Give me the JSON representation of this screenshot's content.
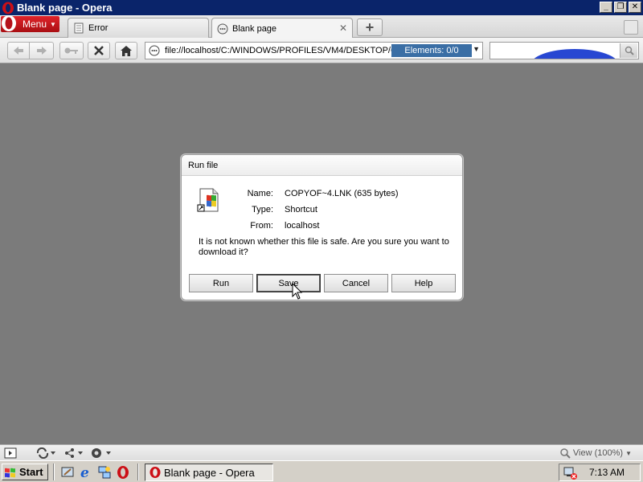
{
  "window": {
    "title": "Blank page - Opera"
  },
  "menu": {
    "label": "Menu"
  },
  "tabs": [
    {
      "label": "Error"
    },
    {
      "label": "Blank page"
    }
  ],
  "address": {
    "url": "file://localhost/C:/WINDOWS/PROFILES/VM4/DESKTOP/CC",
    "elements": "Elements:  0/0"
  },
  "dialog": {
    "title": "Run file",
    "name_label": "Name:",
    "name_value": "COPYOF~4.LNK (635 bytes)",
    "type_label": "Type:",
    "type_value": "Shortcut",
    "from_label": "From:",
    "from_value": "localhost",
    "message": "It is not known whether this file is safe. Are you sure you want to download it?",
    "buttons": {
      "run": "Run",
      "save": "Save",
      "cancel": "Cancel",
      "help": "Help"
    }
  },
  "statusbar": {
    "zoom": "View (100%)"
  },
  "taskbar": {
    "start": "Start",
    "task": "Blank page - Opera",
    "clock": "7:13 AM"
  },
  "colors": {
    "titlebar": "#0a246a",
    "opera_red": "#cc0f16",
    "page_bg": "#7b7b7b",
    "elements_bg": "#3a6ea5"
  }
}
